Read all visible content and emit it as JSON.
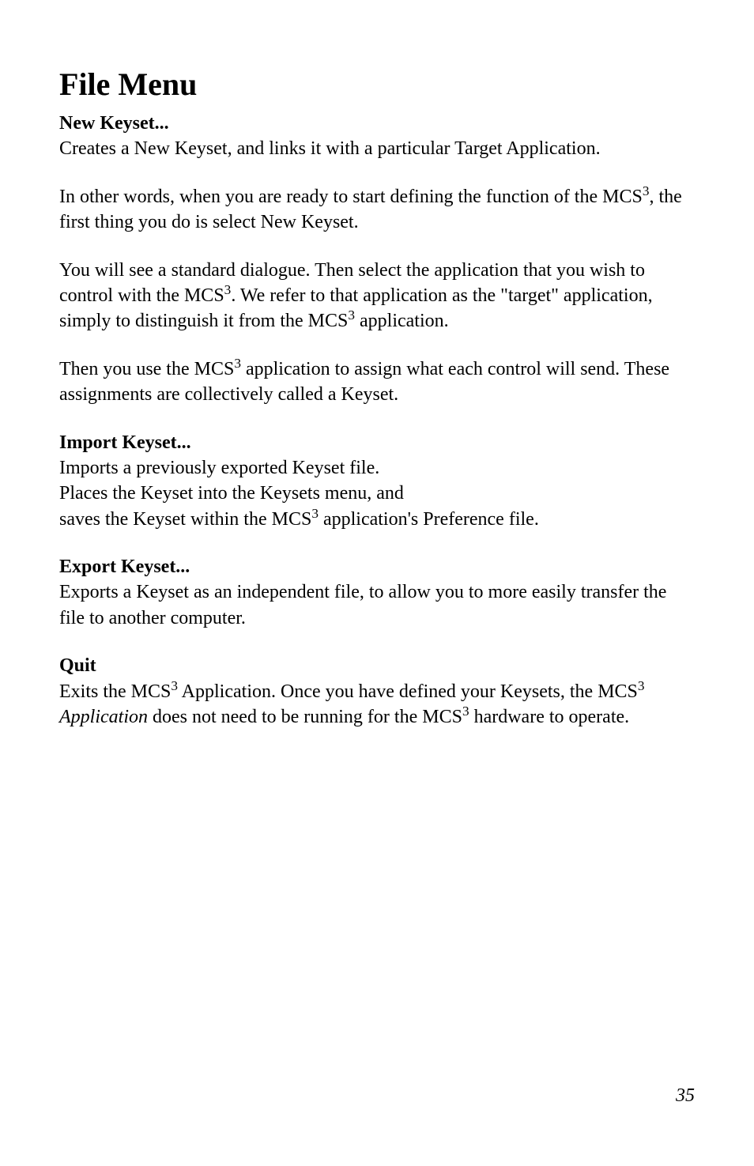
{
  "title": "File Menu",
  "sections": {
    "new_keyset": {
      "heading": "New Keyset...",
      "p1": "Creates a New Keyset, and links it with a particular Target Application.",
      "p2a": "In other words, when you are ready to start defining the function of the MCS",
      "p2sup": "3",
      "p2b": ", the first thing you do is select New Keyset.",
      "p3a": "You will see a standard dialogue. Then select the application that you wish to control with the MCS",
      "p3s1": "3",
      "p3b": ". We refer to that application as the \"target\" application, simply to distinguish it from the MCS",
      "p3s2": "3",
      "p3c": " application.",
      "p4a": "Then you use the MCS",
      "p4s1": "3",
      "p4b": " application to assign what each control will send. These assignments are collectively called a Keyset."
    },
    "import_keyset": {
      "heading": "Import Keyset...",
      "l1": "Imports a previously exported Keyset file.",
      "l2": "Places the Keyset into the Keysets menu, and",
      "l3a": "saves the Keyset within the MCS",
      "l3s": "3",
      "l3b": " application's Preference file."
    },
    "export_keyset": {
      "heading": "Export Keyset...",
      "p1": "Exports a Keyset as an independent file, to allow you to more easily transfer the file to another computer."
    },
    "quit": {
      "heading": "Quit",
      "p1a": "Exits the MCS",
      "p1s1": "3",
      "p1b": " Application. Once you have defined your Keysets, the MCS",
      "p1s2": "3",
      "p1it": " Application",
      "p1c": " does not need to be running for the MCS",
      "p1s3": "3",
      "p1d": " hardware to operate."
    }
  },
  "page_number": "35"
}
